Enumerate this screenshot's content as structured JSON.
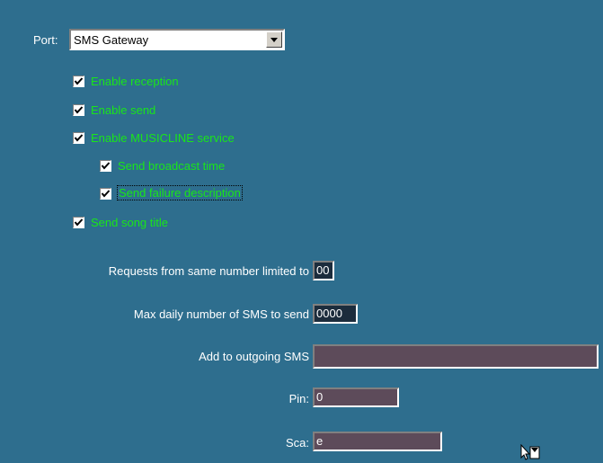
{
  "port": {
    "label": "Port:",
    "value": "SMS Gateway"
  },
  "checkboxes": [
    {
      "label": "Enable reception",
      "checked": true
    },
    {
      "label": "Enable send",
      "checked": true
    },
    {
      "label": "Enable MUSICLINE service",
      "checked": true
    },
    {
      "label": "Send broadcast time",
      "checked": true
    },
    {
      "label": "Send failure description",
      "checked": true
    },
    {
      "label": "Send song title",
      "checked": true
    }
  ],
  "fields": {
    "requests_limit": {
      "label": "Requests from same number limited to",
      "value": "00"
    },
    "max_daily": {
      "label": "Max daily number of SMS to send",
      "value": "0000"
    },
    "add_outgoing": {
      "label": "Add to outgoing SMS",
      "value": ""
    },
    "pin": {
      "label": "Pin:",
      "value": "0"
    },
    "sca": {
      "label": "Sca:",
      "value": "e"
    }
  },
  "colors": {
    "background": "#2e6e8e",
    "checkbox_label": "#19e619",
    "field_bg": "#5d4b5a"
  },
  "icons": {
    "cursor": "busy-cursor-icon"
  }
}
